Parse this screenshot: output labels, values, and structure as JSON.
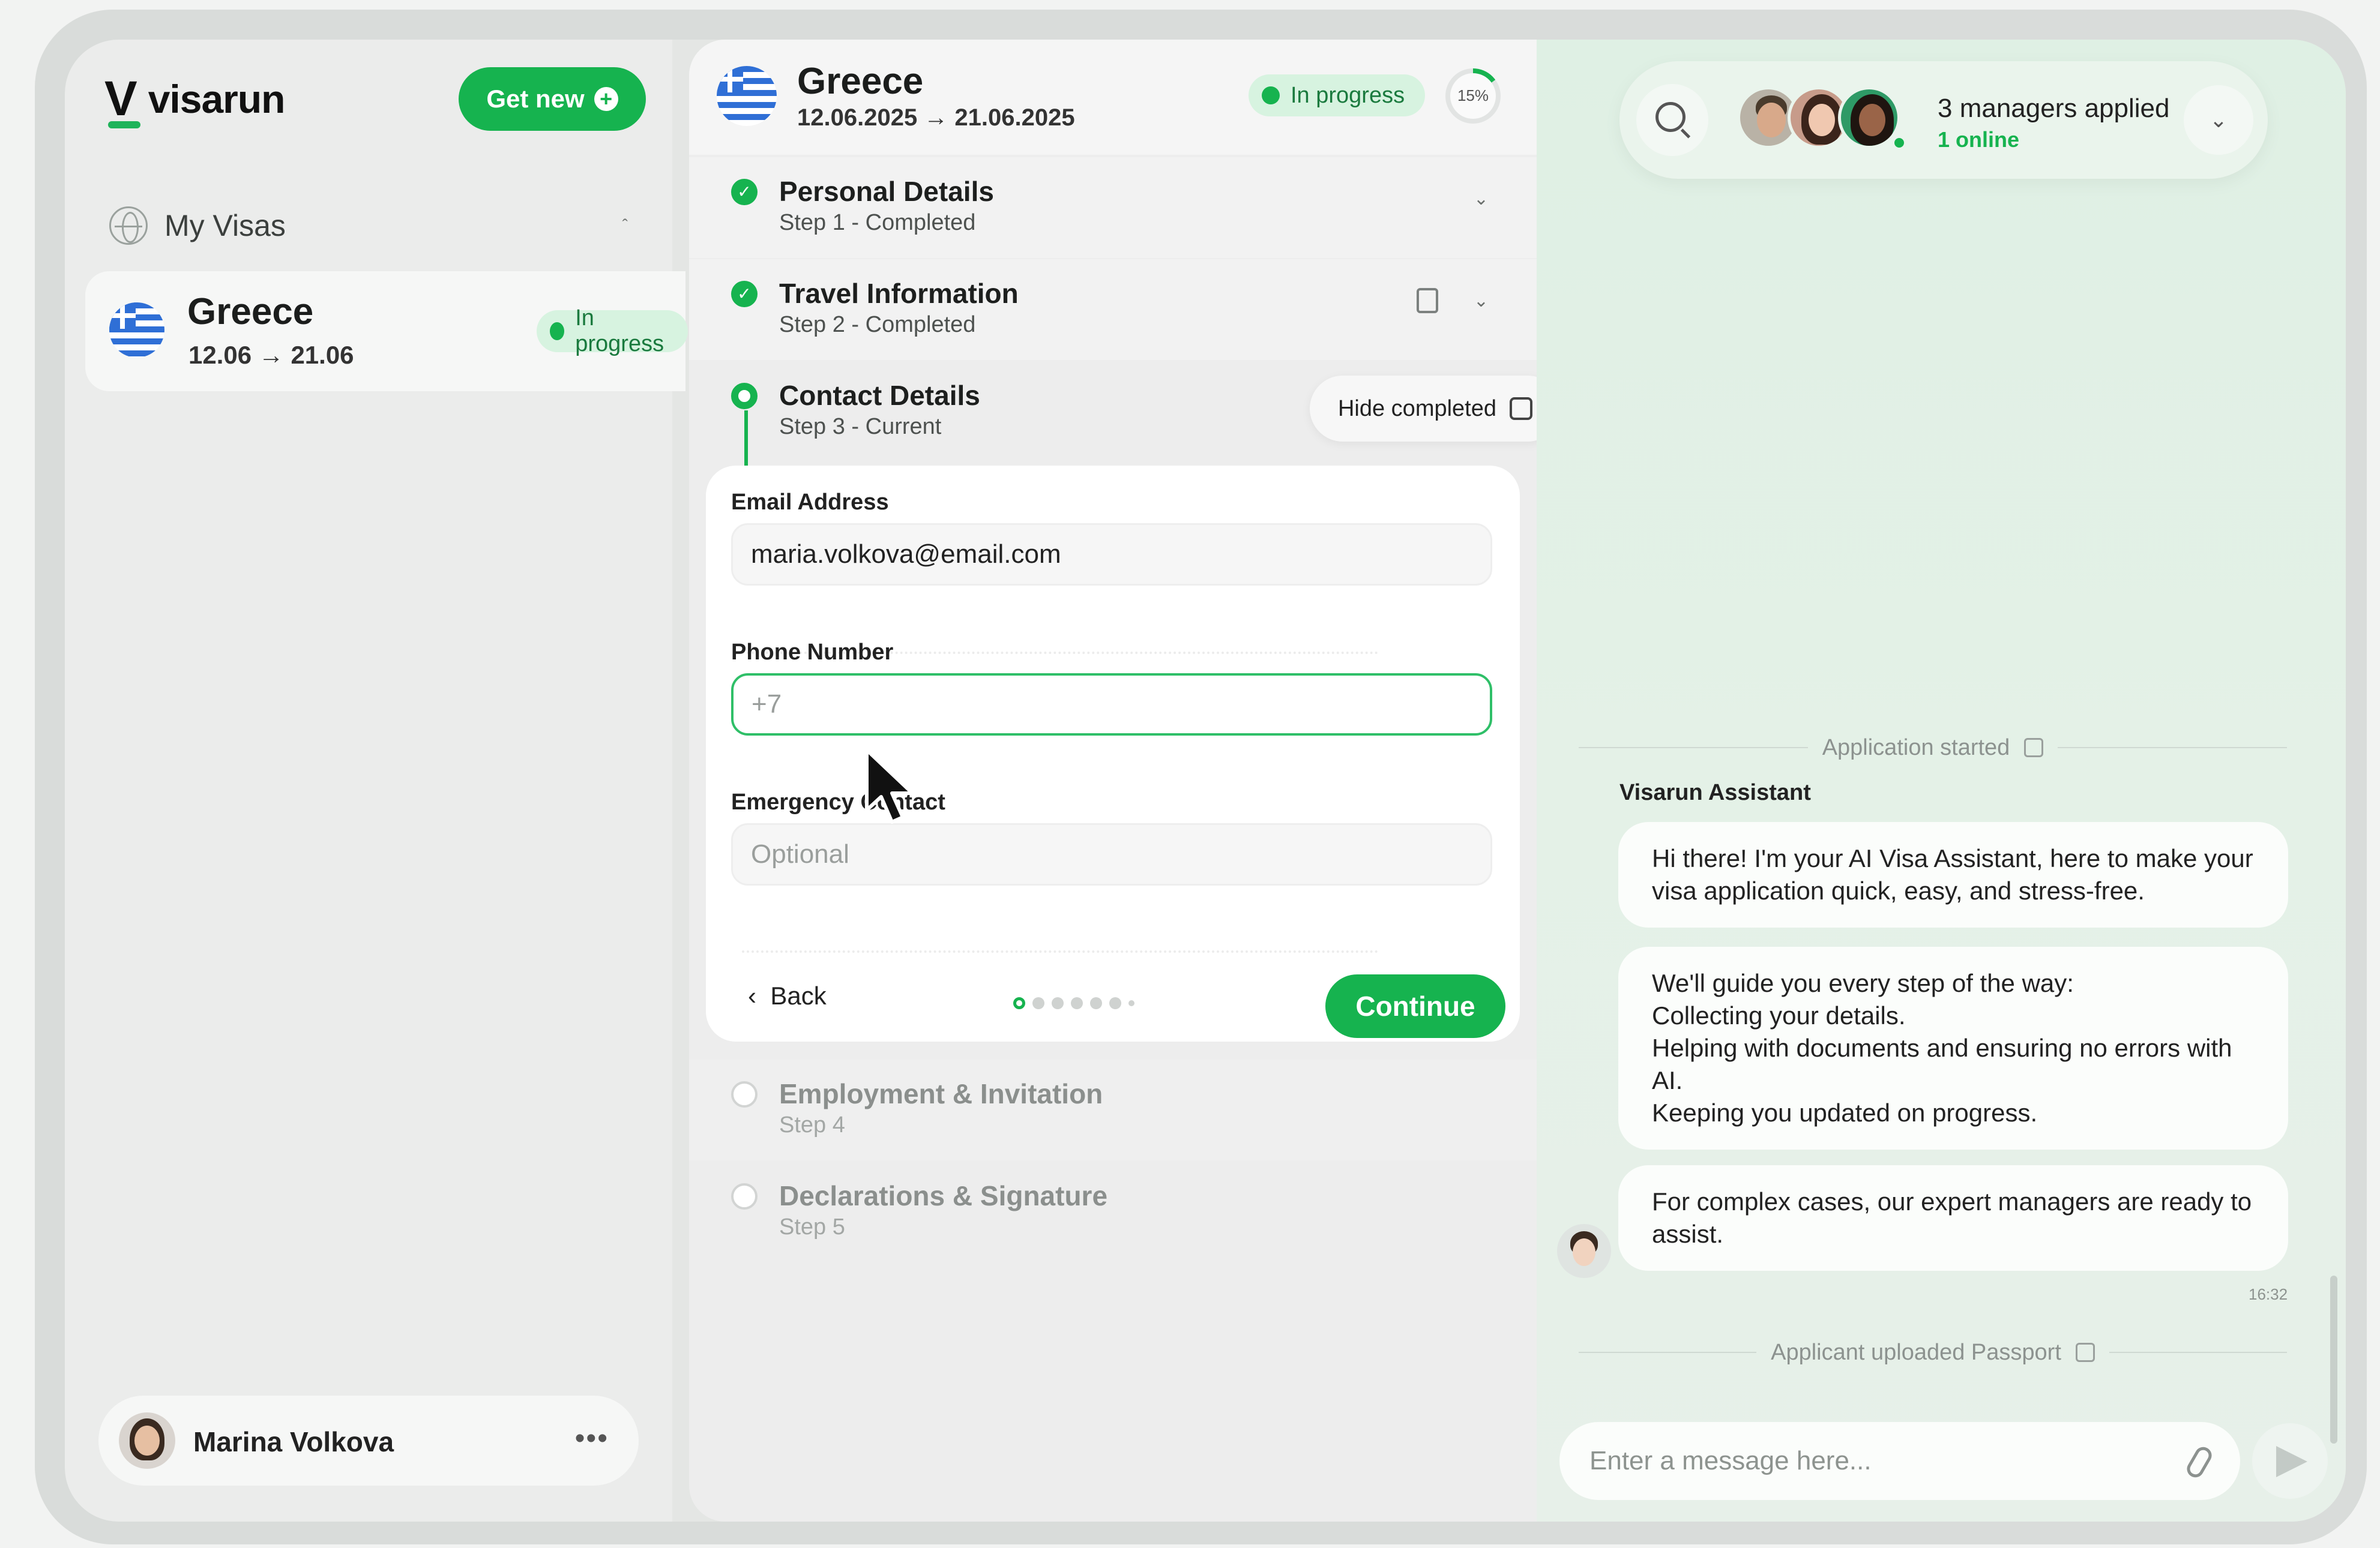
{
  "app": {
    "logo_mark": "V",
    "logo_text": "visarun"
  },
  "sidebar": {
    "get_new_label": "Get new",
    "section_label": "My Visas",
    "visas": [
      {
        "country": "Greece",
        "dates": "12.06 → 21.06",
        "status": "In progress"
      }
    ],
    "user": {
      "name": "Marina Volkova"
    }
  },
  "application": {
    "country": "Greece",
    "dates": "12.06.2025 → 21.06.2025",
    "status": "In progress",
    "progress_percent": 15,
    "progress_label": "15%",
    "hide_completed_label": "Hide completed",
    "steps": [
      {
        "title": "Personal Details",
        "subtitle": "Step 1 - Completed",
        "state": "completed"
      },
      {
        "title": "Travel Information",
        "subtitle": "Step 2 - Completed",
        "state": "completed"
      },
      {
        "title": "Contact Details",
        "subtitle": "Step 3 - Current",
        "state": "current"
      },
      {
        "title": "Employment & Invitation",
        "subtitle": "Step 4",
        "state": "pending"
      },
      {
        "title": "Declarations & Signature",
        "subtitle": "Step 5",
        "state": "pending"
      }
    ],
    "form": {
      "email_label": "Email Address",
      "email_value": "maria.volkova@email.com",
      "phone_label": "Phone Number",
      "phone_placeholder": "+7",
      "emergency_label": "Emergency Contact",
      "emergency_placeholder": "Optional",
      "back_label": "Back",
      "continue_label": "Continue"
    }
  },
  "chat": {
    "managers_title": "3 managers applied",
    "managers_online": "1 online",
    "event_started": "Application started",
    "assistant_name": "Visarun Assistant",
    "messages": [
      "Hi there! I'm your AI Visa Assistant, here to make your visa application quick, easy, and stress-free.",
      "We'll guide you every step of the way:\nCollecting your details.\nHelping with documents and ensuring no errors with AI.\nKeeping you updated on progress.",
      "For complex cases, our expert managers are ready to assist."
    ],
    "message_time": "16:32",
    "event_uploaded": "Applicant uploaded Passport",
    "input_placeholder": "Enter a message here..."
  },
  "colors": {
    "accent": "#16b34f",
    "pill_bg": "#d7f3e0"
  },
  "icons": [
    "plus-icon",
    "globe-icon",
    "flag-icon",
    "check-icon",
    "document-icon",
    "chevron-down-icon",
    "search-icon",
    "paperclip-icon",
    "send-icon",
    "more-icon"
  ]
}
